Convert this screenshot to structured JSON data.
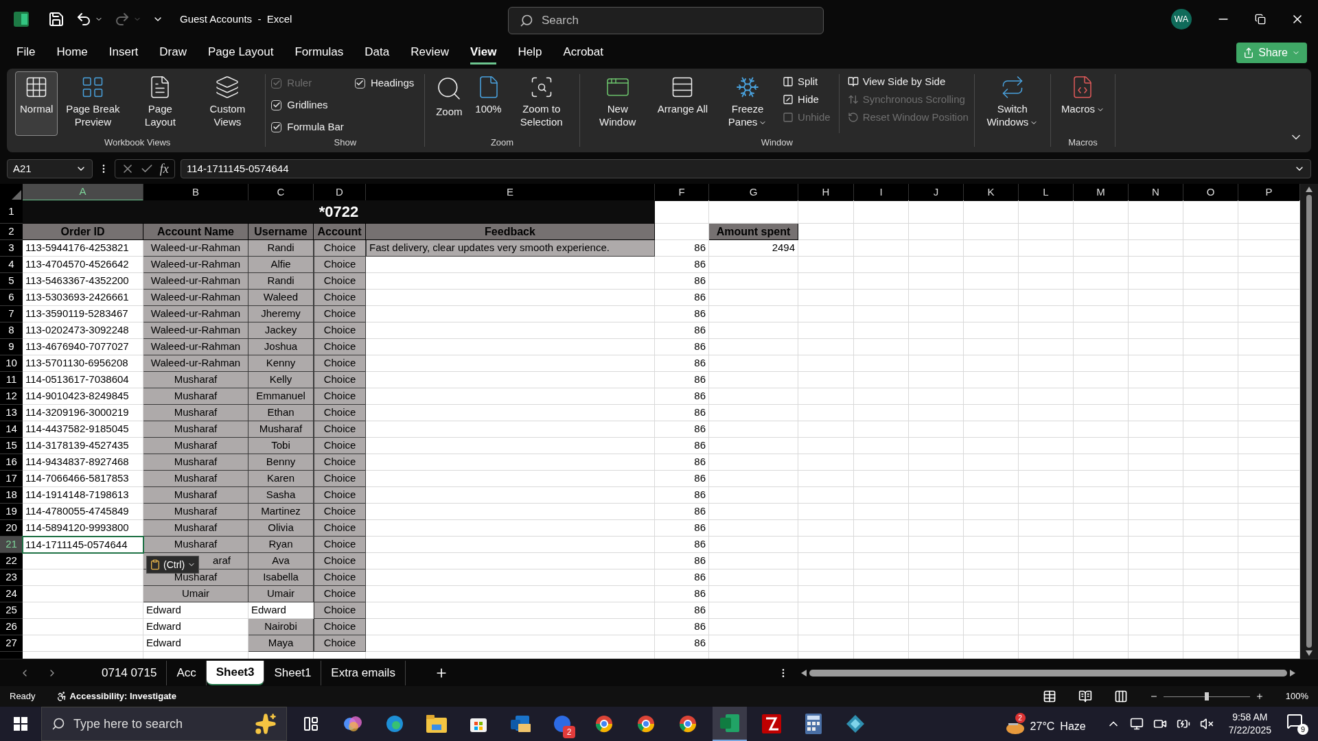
{
  "title_bar": {
    "title": "Guest Accounts  -  Excel",
    "search_placeholder": "Search",
    "avatar": "WA"
  },
  "menu": [
    {
      "label": "File",
      "selected": false
    },
    {
      "label": "Home",
      "selected": false
    },
    {
      "label": "Insert",
      "selected": false
    },
    {
      "label": "Draw",
      "selected": false
    },
    {
      "label": "Page Layout",
      "selected": false
    },
    {
      "label": "Formulas",
      "selected": false
    },
    {
      "label": "Data",
      "selected": false
    },
    {
      "label": "Review",
      "selected": false
    },
    {
      "label": "View",
      "selected": true
    },
    {
      "label": "Help",
      "selected": false
    },
    {
      "label": "Acrobat",
      "selected": false
    }
  ],
  "share_button": "Share",
  "ribbon": {
    "workbook_views": {
      "label": "Workbook Views",
      "buttons": [
        {
          "label": "Normal",
          "selected": true
        },
        {
          "label": "Page Break Preview",
          "selected": false
        },
        {
          "label": "Page Layout",
          "selected": false
        },
        {
          "label": "Custom Views",
          "selected": false
        }
      ]
    },
    "show": {
      "label": "Show",
      "checkboxes": [
        {
          "label": "Ruler",
          "checked": true,
          "disabled": true
        },
        {
          "label": "Gridlines",
          "checked": true,
          "disabled": false
        },
        {
          "label": "Formula Bar",
          "checked": true,
          "disabled": false
        },
        {
          "label": "Headings",
          "checked": true,
          "disabled": false
        }
      ]
    },
    "zoom": {
      "label": "Zoom",
      "buttons": [
        "Zoom",
        "100%",
        "Zoom to Selection"
      ]
    },
    "window": {
      "label": "Window",
      "big_buttons": [
        {
          "label": "New Window",
          "dropdown": false
        },
        {
          "label": "Arrange All",
          "dropdown": false
        },
        {
          "label": "Freeze Panes",
          "dropdown": true
        }
      ],
      "small_buttons": [
        {
          "label": "Split",
          "disabled": false
        },
        {
          "label": "Hide",
          "disabled": false
        },
        {
          "label": "Unhide",
          "disabled": true
        },
        {
          "label": "View Side by Side",
          "disabled": false
        },
        {
          "label": "Synchronous Scrolling",
          "disabled": true
        },
        {
          "label": "Reset Window Position",
          "disabled": true
        }
      ],
      "switch_windows": "Switch Windows"
    },
    "macros": {
      "label": "Macros",
      "button": "Macros"
    }
  },
  "formula_bar": {
    "name_box": "A21",
    "fx": "fx",
    "value": "114-1711145-0574644"
  },
  "columns": [
    {
      "letter": "A",
      "selected": true
    },
    {
      "letter": "B",
      "selected": false
    },
    {
      "letter": "C",
      "selected": false
    },
    {
      "letter": "D",
      "selected": false
    },
    {
      "letter": "E",
      "selected": false
    },
    {
      "letter": "F",
      "selected": false
    },
    {
      "letter": "G",
      "selected": false
    },
    {
      "letter": "H",
      "selected": false
    },
    {
      "letter": "I",
      "selected": false
    },
    {
      "letter": "J",
      "selected": false
    },
    {
      "letter": "K",
      "selected": false
    },
    {
      "letter": "L",
      "selected": false
    },
    {
      "letter": "M",
      "selected": false
    },
    {
      "letter": "N",
      "selected": false
    },
    {
      "letter": "O",
      "selected": false
    },
    {
      "letter": "P",
      "selected": false
    }
  ],
  "title_row": {
    "number": "1",
    "text": "*0722"
  },
  "header_row": {
    "number": "2",
    "order_id": "Order ID",
    "account_name": "Account Name",
    "username": "Username",
    "account": "Account",
    "feedback": "Feedback",
    "amount_spent": "Amount spent"
  },
  "rows": [
    {
      "number": "3",
      "selected": false,
      "order_id": "113-5944176-4253821",
      "account_name": "Waleed-ur-Rahman",
      "account_name_shaded": true,
      "username": "Randi",
      "username_shaded": true,
      "account": "Choice",
      "feedback": "Fast delivery, clear updates very smooth experience.",
      "column_f": "86",
      "amount_spent": "2494"
    },
    {
      "number": "4",
      "selected": false,
      "order_id": "113-4704570-4526642",
      "account_name": "Waleed-ur-Rahman",
      "account_name_shaded": true,
      "username": "Alfie",
      "username_shaded": true,
      "account": "Choice",
      "column_f": "86"
    },
    {
      "number": "5",
      "selected": false,
      "order_id": "113-5463367-4352200",
      "account_name": "Waleed-ur-Rahman",
      "account_name_shaded": true,
      "username": "Randi",
      "username_shaded": true,
      "account": "Choice",
      "column_f": "86"
    },
    {
      "number": "6",
      "selected": false,
      "order_id": "113-5303693-2426661",
      "account_name": "Waleed-ur-Rahman",
      "account_name_shaded": true,
      "username": "Waleed",
      "username_shaded": true,
      "account": "Choice",
      "column_f": "86"
    },
    {
      "number": "7",
      "selected": false,
      "order_id": "113-3590119-5283467",
      "account_name": "Waleed-ur-Rahman",
      "account_name_shaded": true,
      "username": "Jheremy",
      "username_shaded": true,
      "account": "Choice",
      "column_f": "86"
    },
    {
      "number": "8",
      "selected": false,
      "order_id": "113-0202473-3092248",
      "account_name": "Waleed-ur-Rahman",
      "account_name_shaded": true,
      "username": "Jackey",
      "username_shaded": true,
      "account": "Choice",
      "column_f": "86"
    },
    {
      "number": "9",
      "selected": false,
      "order_id": "113-4676940-7077027",
      "account_name": "Waleed-ur-Rahman",
      "account_name_shaded": true,
      "username": "Joshua",
      "username_shaded": true,
      "account": "Choice",
      "column_f": "86"
    },
    {
      "number": "10",
      "selected": false,
      "order_id": "113-5701130-6956208",
      "account_name": "Waleed-ur-Rahman",
      "account_name_shaded": true,
      "username": "Kenny",
      "username_shaded": true,
      "account": "Choice",
      "column_f": "86"
    },
    {
      "number": "11",
      "selected": false,
      "order_id": "114-0513617-7038604",
      "account_name": "Musharaf",
      "account_name_shaded": true,
      "username": "Kelly",
      "username_shaded": true,
      "account": "Choice",
      "column_f": "86"
    },
    {
      "number": "12",
      "selected": false,
      "order_id": "114-9010423-8249845",
      "account_name": "Musharaf",
      "account_name_shaded": true,
      "username": "Emmanuel",
      "username_shaded": true,
      "account": "Choice",
      "column_f": "86"
    },
    {
      "number": "13",
      "selected": false,
      "order_id": "114-3209196-3000219",
      "account_name": "Musharaf",
      "account_name_shaded": true,
      "username": "Ethan",
      "username_shaded": true,
      "account": "Choice",
      "column_f": "86"
    },
    {
      "number": "14",
      "selected": false,
      "order_id": "114-4437582-9185045",
      "account_name": "Musharaf",
      "account_name_shaded": true,
      "username": "Musharaf",
      "username_shaded": true,
      "account": "Choice",
      "column_f": "86"
    },
    {
      "number": "15",
      "selected": false,
      "order_id": "114-3178139-4527435",
      "account_name": "Musharaf",
      "account_name_shaded": true,
      "username": "Tobi",
      "username_shaded": true,
      "account": "Choice",
      "column_f": "86"
    },
    {
      "number": "16",
      "selected": false,
      "order_id": "114-9434837-8927468",
      "account_name": "Musharaf",
      "account_name_shaded": true,
      "username": "Benny",
      "username_shaded": true,
      "account": "Choice",
      "column_f": "86"
    },
    {
      "number": "17",
      "selected": false,
      "order_id": "114-7066466-5817853",
      "account_name": "Musharaf",
      "account_name_shaded": true,
      "username": "Karen",
      "username_shaded": true,
      "account": "Choice",
      "column_f": "86"
    },
    {
      "number": "18",
      "selected": false,
      "order_id": "114-1914148-7198613",
      "account_name": "Musharaf",
      "account_name_shaded": true,
      "username": "Sasha",
      "username_shaded": true,
      "account": "Choice",
      "column_f": "86"
    },
    {
      "number": "19",
      "selected": false,
      "order_id": "114-4780055-4745849",
      "account_name": "Musharaf",
      "account_name_shaded": true,
      "username": "Martinez",
      "username_shaded": true,
      "account": "Choice",
      "column_f": "86"
    },
    {
      "number": "20",
      "selected": false,
      "order_id": "114-5894120-9993800",
      "account_name": "Musharaf",
      "account_name_shaded": true,
      "username": "Olivia",
      "username_shaded": true,
      "account": "Choice",
      "column_f": "86"
    },
    {
      "number": "21",
      "selected": true,
      "order_id": "114-1711145-0574644",
      "account_name": "Musharaf",
      "account_name_shaded": true,
      "username": "Ryan",
      "username_shaded": true,
      "account": "Choice",
      "column_f": "86"
    },
    {
      "number": "22",
      "selected": false,
      "account_name": "araf",
      "account_name_shaded": true,
      "paste_options": "(Ctrl)",
      "username": "Ava",
      "username_shaded": true,
      "account": "Choice",
      "column_f": "86"
    },
    {
      "number": "23",
      "selected": false,
      "account_name": "Musharaf",
      "account_name_shaded": true,
      "username": "Isabella",
      "username_shaded": true,
      "account": "Choice",
      "column_f": "86"
    },
    {
      "number": "24",
      "selected": false,
      "account_name": "Umair",
      "account_name_shaded": true,
      "username": "Umair",
      "username_shaded": true,
      "account": "Choice",
      "column_f": "86"
    },
    {
      "number": "25",
      "selected": false,
      "account_name": "Edward",
      "account_name_shaded": false,
      "username": "Edward",
      "username_shaded": false,
      "account": "Choice",
      "column_f": "86"
    },
    {
      "number": "26",
      "selected": false,
      "account_name": "Edward",
      "account_name_shaded": false,
      "username": "Nairobi",
      "username_shaded": true,
      "account": "Choice",
      "column_f": "86"
    },
    {
      "number": "27",
      "selected": false,
      "account_name": "Edward",
      "account_name_shaded": false,
      "username": "Maya",
      "username_shaded": true,
      "account": "Choice",
      "column_f": "86"
    }
  ],
  "sheet_tabs": [
    {
      "label": "0714 0715",
      "selected": false
    },
    {
      "label": "Acc",
      "selected": false
    },
    {
      "label": "Sheet3",
      "selected": true
    },
    {
      "label": "Sheet1",
      "selected": false
    },
    {
      "label": "Extra emails",
      "selected": false
    }
  ],
  "status_bar": {
    "ready": "Ready",
    "accessibility": "Accessibility: Investigate",
    "zoom_level": {
      "level": 0.5
    },
    "zoom": "100%"
  },
  "taskbar": {
    "search_placeholder": "Type here to search",
    "video_badge": "2",
    "weather_badge": "2",
    "temperature": "27°C",
    "condition": "Haze",
    "time": "9:58 AM",
    "date": "7/22/2025",
    "notifications": "9"
  }
}
